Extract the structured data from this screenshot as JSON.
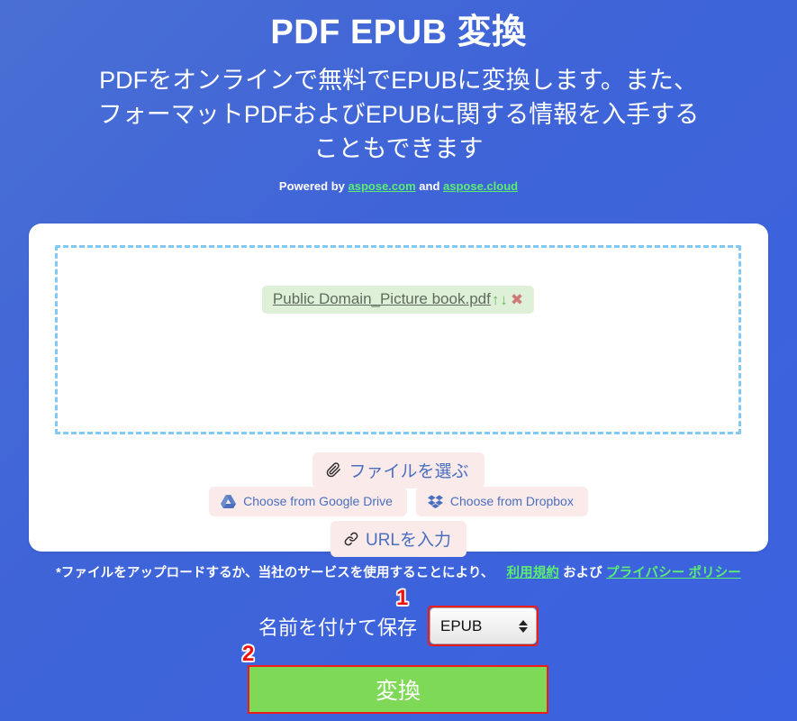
{
  "hero": {
    "title": "PDF EPUB 変換",
    "subtitle": "PDFをオンラインで無料でEPUBに変換します。また、フォーマットPDFおよびEPUBに関する情報を入手することもできます",
    "powered_prefix": "Powered by ",
    "powered_link1": "aspose.com",
    "powered_and": " and ",
    "powered_link2": "aspose.cloud"
  },
  "dropzone": {
    "file_name": "Public Domain_Picture book.pdf",
    "move_up_icon": "↑",
    "move_down_icon": "↓",
    "remove_icon": "✖"
  },
  "sources": {
    "choose_file": "ファイルを選ぶ",
    "google_drive": "Choose from Google Drive",
    "dropbox": "Choose from Dropbox",
    "enter_url": "URLを入力"
  },
  "terms": {
    "text_before": "*ファイルをアップロードするか、当社のサービスを使用することにより、",
    "link_terms": "利用規約",
    "conjunction": "および",
    "link_privacy": "プライバシー ポリシー"
  },
  "saveas": {
    "label": "名前を付けて保存",
    "selected_format": "EPUB",
    "options": [
      "EPUB"
    ]
  },
  "convert": {
    "label": "変換"
  },
  "annotations": {
    "one": "1",
    "two": "2"
  },
  "colors": {
    "background": "#3f64d8",
    "card": "#ffffff",
    "dropzone_border": "#82c8f5",
    "file_chip_bg": "#dff0d8",
    "source_button_bg": "#fbeaea",
    "source_button_text": "#4a6fbf",
    "link_green": "#5bed72",
    "convert_green": "#7ed957",
    "annotation_red": "#ee1111"
  }
}
